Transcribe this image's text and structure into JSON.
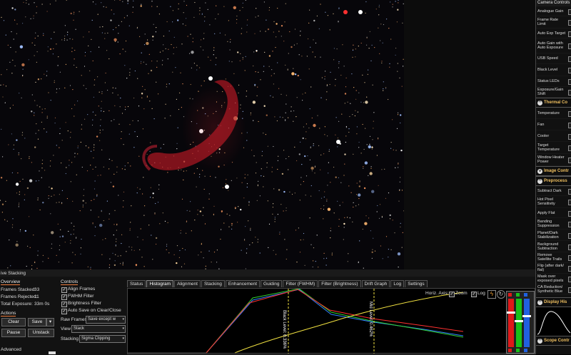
{
  "window_title": "ive Stacking",
  "overview": {
    "header": "Overview",
    "frames_stacked_label": "Frames Stacked:",
    "frames_stacked": "33",
    "frames_rejected_label": "Frames Rejected:",
    "frames_rejected": "11",
    "total_exposure_label": "Total Exposure:",
    "total_exposure": "33m 0s"
  },
  "actions": {
    "header": "Actions",
    "clear": "Clear",
    "save": "Save",
    "pause": "Pause",
    "unstack": "Unstack"
  },
  "advanced_label": "Advanced",
  "controls": {
    "header": "Controls",
    "align_frames": "Align Frames",
    "fwhm_filter": "FWHM Filter",
    "brightness_filter": "Brightness Filter",
    "auto_save": "Auto Save on Clear/Close",
    "raw_frames_label": "Raw Frames",
    "raw_frames_value": "Save except w",
    "view_label": "View",
    "view_value": "Stack",
    "stacking_label": "Stacking",
    "stacking_value": "Sigma Clipping"
  },
  "tabs": [
    "Status",
    "Histogram",
    "Alignment",
    "Stacking",
    "Enhancement",
    "Guiding",
    "Filter (FWHM)",
    "Filter (Brightness)",
    "Drift Graph",
    "Log",
    "Settings"
  ],
  "histogram": {
    "horiz_axis_label": "Horiz. Axis:",
    "zoom_label": "Zoom",
    "log_label": "Log",
    "black_level": "Black Level: 0.336%",
    "mid_level": "Mid Level: 0.462%",
    "channel_colors": [
      "#ff3030",
      "#30d030",
      "#3080ff",
      "#f0e040"
    ]
  },
  "camera_controls": {
    "title": "Camera Controls",
    "items": [
      "Analogue Gain",
      "Frame Rate Limit",
      "Auto Exp Target",
      "Auto Gain with Auto Exposure",
      "USB Speed",
      "Black Level",
      "Status LEDs",
      "Exposure/Gain Shift"
    ]
  },
  "thermal": {
    "title": "Thermal Co",
    "items": [
      "Temperature",
      "Fan",
      "Cooler",
      "Target Temperature",
      "Window Heater Power"
    ]
  },
  "image_controls_title": "Image Contr",
  "preprocessing": {
    "title": "Preprocess",
    "items": [
      "Subtract Dark",
      "Hot Pixel Sensitivity",
      "Apply Flat",
      "Banding Suppression",
      "Planet/Dark Stabilization",
      "Background Subtraction",
      "Remove Satellite Trails",
      "Flip (after dark/ flat)",
      "Mask over exposed pixels",
      "CA Reduction/ Synthetic Blue"
    ]
  },
  "display_histogram_title": "Display His",
  "scope_controls_title": "Scope Contr"
}
